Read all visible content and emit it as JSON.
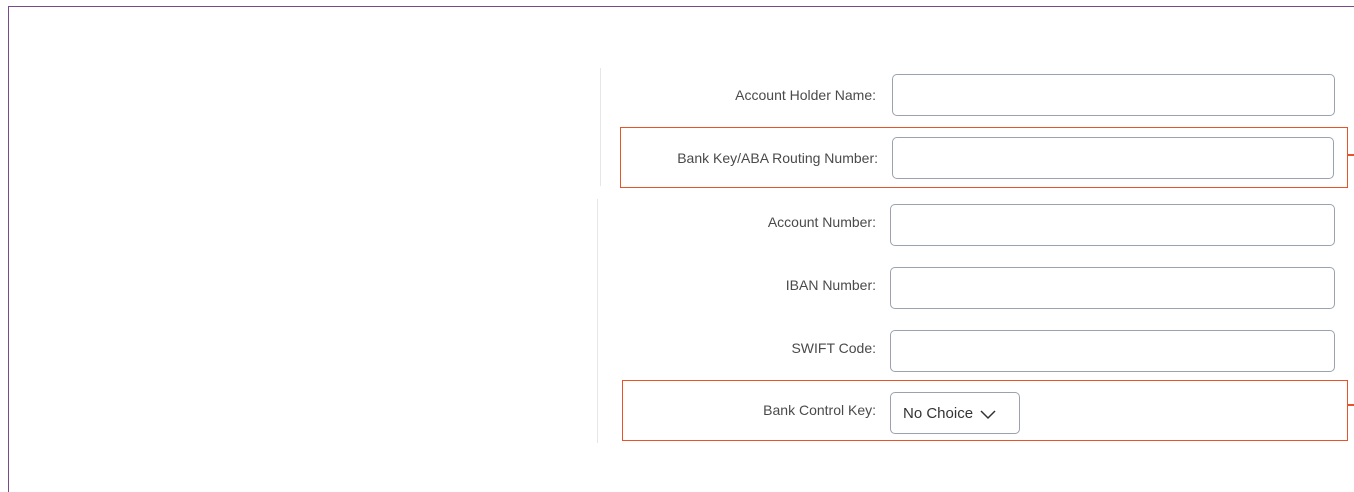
{
  "form": {
    "account_holder_name": {
      "label": "Account Holder Name:",
      "value": ""
    },
    "bank_key": {
      "label": "Bank Key/ABA Routing Number:",
      "value": ""
    },
    "account_number": {
      "label": "Account Number:",
      "value": ""
    },
    "iban_number": {
      "label": "IBAN Number:",
      "value": ""
    },
    "swift_code": {
      "label": "SWIFT Code:",
      "value": ""
    },
    "bank_control_key": {
      "label": "Bank Control Key:",
      "selected": "No Choice"
    }
  },
  "icons": {
    "dropdown": "chevron-down-icon"
  },
  "colors": {
    "highlight": "#e8542a",
    "frame": "#7a4b8c"
  }
}
